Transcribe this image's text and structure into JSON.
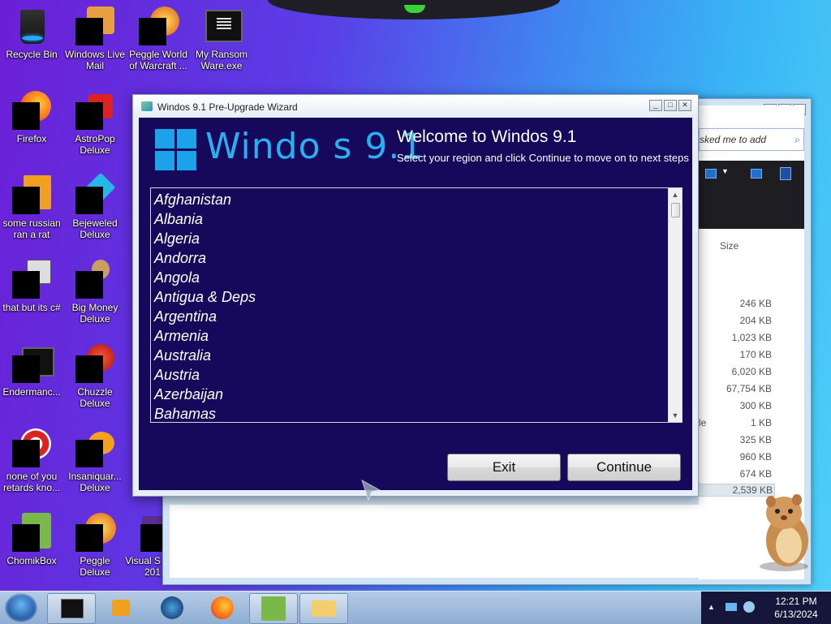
{
  "desktop": {
    "icons": [
      {
        "label": "Recycle Bin"
      },
      {
        "label": "Windows Live Mail"
      },
      {
        "label": "Peggle World of Warcraft ..."
      },
      {
        "label": "My Ransom Ware.exe"
      },
      {
        "label": "Firefox"
      },
      {
        "label": "AstroPop Deluxe"
      },
      {
        "label": "some russian ran a rat"
      },
      {
        "label": "Bejeweled Deluxe"
      },
      {
        "label": "that but its c#"
      },
      {
        "label": "Big Money Deluxe"
      },
      {
        "label": "Endermanc..."
      },
      {
        "label": "Chuzzle Deluxe"
      },
      {
        "label": "none of you retards kno..."
      },
      {
        "label": "Insaniquar... Deluxe"
      },
      {
        "label": "ChomikBox"
      },
      {
        "label": "Peggle Deluxe"
      },
      {
        "label": "Visual S 201"
      }
    ]
  },
  "explorer": {
    "search_placeholder": "sked me to add",
    "size_header": "Size",
    "sizes": [
      "246 KB",
      "204 KB",
      "1,023 KB",
      "170 KB",
      "6,020 KB",
      "67,754 KB",
      "300 KB",
      "1 KB",
      "325 KB",
      "960 KB",
      "674 KB",
      "2,539 KB"
    ],
    "fragment": "le"
  },
  "wizard": {
    "title": "Windos 9.1 Pre-Upgrade Wizard",
    "logo_text": "Windo s 9.1",
    "heading": "Welcome to Windos 9.1",
    "subheading": "Select your region and click Continue to move on to next steps",
    "countries": [
      "Afghanistan",
      "Albania",
      "Algeria",
      "Andorra",
      "Angola",
      "Antigua & Deps",
      "Argentina",
      "Armenia",
      "Australia",
      "Austria",
      "Azerbaijan",
      "Bahamas"
    ],
    "exit_label": "Exit",
    "continue_label": "Continue"
  },
  "taskbar": {
    "time": "12:21 PM",
    "date": "6/13/2024"
  },
  "colors": {
    "wizard_bg": "#16085a",
    "logo_blue": "#1aa3ea"
  }
}
